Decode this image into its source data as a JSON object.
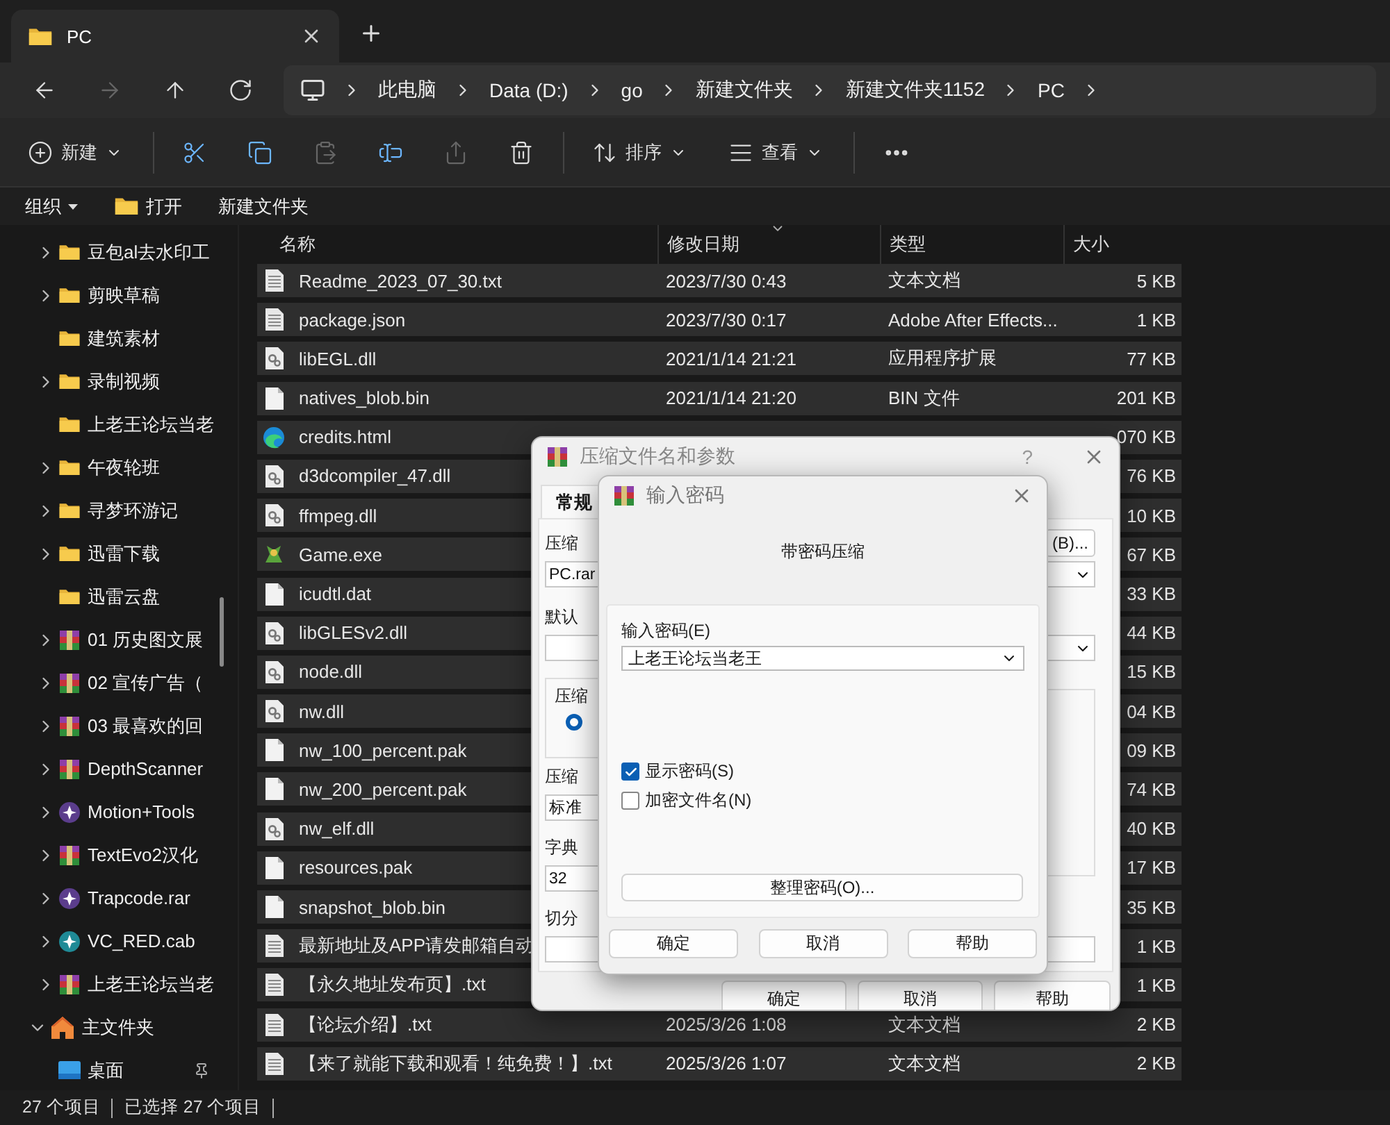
{
  "tab": {
    "title": "PC"
  },
  "nav_buttons": [
    {
      "kind": "back",
      "disabled": false
    },
    {
      "kind": "forward",
      "disabled": true
    },
    {
      "kind": "up",
      "disabled": false
    },
    {
      "kind": "refresh",
      "disabled": false
    }
  ],
  "breadcrumb": [
    "此电脑",
    "Data (D:)",
    "go",
    "新建文件夹",
    "新建文件夹1152",
    "PC"
  ],
  "toolbar": [
    {
      "kind": "new",
      "label": "新建",
      "disabled": false
    },
    {
      "kind": "cut",
      "disabled": false
    },
    {
      "kind": "copy",
      "disabled": false
    },
    {
      "kind": "paste",
      "disabled": true
    },
    {
      "kind": "rename",
      "disabled": false
    },
    {
      "kind": "share",
      "disabled": true
    },
    {
      "kind": "delete",
      "disabled": false
    },
    {
      "kind": "sort",
      "label": "排序",
      "disabled": false
    },
    {
      "kind": "view",
      "label": "查看",
      "disabled": false
    },
    {
      "kind": "more",
      "disabled": false
    }
  ],
  "command_bar": [
    {
      "kind": "menu",
      "label": "组织"
    },
    {
      "kind": "open",
      "label": "打开"
    },
    {
      "kind": "plain",
      "label": "新建文件夹"
    }
  ],
  "sidebar": {
    "items": [
      {
        "label": "豆包al去水印工",
        "kind": "folder",
        "expandable": true
      },
      {
        "label": "剪映草稿",
        "kind": "folder",
        "expandable": true
      },
      {
        "label": "建筑素材",
        "kind": "folder",
        "expandable": false
      },
      {
        "label": "录制视频",
        "kind": "folder",
        "expandable": true
      },
      {
        "label": "上老王论坛当老",
        "kind": "folder",
        "expandable": false
      },
      {
        "label": "午夜轮班",
        "kind": "folder",
        "expandable": true
      },
      {
        "label": "寻梦环游记",
        "kind": "folder",
        "expandable": true
      },
      {
        "label": "迅雷下载",
        "kind": "folder",
        "expandable": true
      },
      {
        "label": "迅雷云盘",
        "kind": "folder",
        "expandable": false
      },
      {
        "label": "01 历史图文展",
        "kind": "rar",
        "expandable": true
      },
      {
        "label": "02 宣传广告（",
        "kind": "rar",
        "expandable": true
      },
      {
        "label": "03 最喜欢的回",
        "kind": "rar",
        "expandable": true
      },
      {
        "label": "DepthScanner",
        "kind": "rar",
        "expandable": true
      },
      {
        "label": "Motion+Tools",
        "kind": "badge",
        "expandable": true
      },
      {
        "label": "TextEvo2汉化",
        "kind": "rar",
        "expandable": true
      },
      {
        "label": "Trapcode.rar",
        "kind": "badge",
        "expandable": true
      },
      {
        "label": "VC_RED.cab",
        "kind": "cab",
        "expandable": true
      },
      {
        "label": "上老王论坛当老",
        "kind": "rar",
        "expandable": true
      }
    ],
    "home": {
      "label": "主文件夹",
      "expanded": true,
      "children": [
        {
          "label": "桌面",
          "kind": "desktop",
          "pinned": true
        }
      ]
    }
  },
  "table": {
    "columns": [
      {
        "label": "名称",
        "sorted": false
      },
      {
        "label": "修改日期",
        "sorted": true
      },
      {
        "label": "类型",
        "sorted": false
      },
      {
        "label": "大小",
        "sorted": false
      }
    ],
    "rows": [
      {
        "kind": "text",
        "name": "Readme_2023_07_30.txt",
        "date": "2023/7/30 0:43",
        "type": "文本文档",
        "size": "5 KB",
        "selected": true
      },
      {
        "kind": "text",
        "name": "package.json",
        "date": "2023/7/30 0:17",
        "type": "Adobe After Effects...",
        "size": "1 KB",
        "selected": true
      },
      {
        "kind": "dll",
        "name": "libEGL.dll",
        "date": "2021/1/14 21:21",
        "type": "应用程序扩展",
        "size": "77 KB",
        "selected": true
      },
      {
        "kind": "file",
        "name": "natives_blob.bin",
        "date": "2021/1/14 21:20",
        "type": "BIN 文件",
        "size": "201 KB",
        "selected": true
      },
      {
        "kind": "edge",
        "name": "credits.html",
        "size": "070 KB",
        "selected": true
      },
      {
        "kind": "dll",
        "name": "d3dcompiler_47.dll",
        "size": "76 KB",
        "selected": true
      },
      {
        "kind": "dll",
        "name": "ffmpeg.dll",
        "size": "10 KB",
        "selected": true
      },
      {
        "kind": "game",
        "name": "Game.exe",
        "size": "67 KB",
        "selected": true
      },
      {
        "kind": "file",
        "name": "icudtl.dat",
        "size": "33 KB",
        "selected": true
      },
      {
        "kind": "dll",
        "name": "libGLESv2.dll",
        "size": "44 KB",
        "selected": true
      },
      {
        "kind": "dll",
        "name": "node.dll",
        "size": "15 KB",
        "selected": true
      },
      {
        "kind": "dll",
        "name": "nw.dll",
        "size": "04 KB",
        "selected": true
      },
      {
        "kind": "file",
        "name": "nw_100_percent.pak",
        "size": "09 KB",
        "selected": true
      },
      {
        "kind": "file",
        "name": "nw_200_percent.pak",
        "size": "74 KB",
        "selected": true
      },
      {
        "kind": "dll",
        "name": "nw_elf.dll",
        "size": "40 KB",
        "selected": true
      },
      {
        "kind": "file",
        "name": "resources.pak",
        "size": "17 KB",
        "selected": true
      },
      {
        "kind": "file",
        "name": "snapshot_blob.bin",
        "size": "35 KB",
        "selected": true
      },
      {
        "kind": "text",
        "name": "最新地址及APP请发邮箱自动",
        "size": "1 KB",
        "selected": true
      },
      {
        "kind": "text",
        "name": "【永久地址发布页】.txt",
        "size": "1 KB",
        "selected": true
      },
      {
        "kind": "text",
        "name": "【论坛介绍】.txt",
        "date": "2025/3/26 1:08",
        "type": "文本文档",
        "size": "2 KB",
        "selected": true
      },
      {
        "kind": "text",
        "name": "【来了就能下载和观看！纯免费！】.txt",
        "date": "2025/3/26 1:07",
        "type": "文本文档",
        "size": "2 KB",
        "selected": true
      }
    ]
  },
  "status_bar": {
    "count": "27 个项目",
    "selection": "已选择 27 个项目"
  },
  "archive_dialog": {
    "title": "压缩文件名和参数",
    "help": "?",
    "tabs": [
      {
        "label": "常规",
        "selected": true
      }
    ],
    "archive_name_label": "压缩",
    "browse_button": "(B)...",
    "archive_name": "PC.rar",
    "profile_label": "默认",
    "format_group_label": "压缩",
    "format_radio": {
      "selected": true
    },
    "method_label": "压缩",
    "method": "标准",
    "dictionary_label": "字典",
    "dictionary": "32",
    "split_label": "切分",
    "buttons": [
      "确定",
      "取消",
      "帮助"
    ]
  },
  "password_dialog": {
    "title": "输入密码",
    "heading": "带密码压缩",
    "password_label": "输入密码(E)",
    "password": "上老王论坛当老王",
    "options": [
      {
        "label": "显示密码(S)",
        "checked": true
      },
      {
        "label": "加密文件名(N)",
        "checked": false
      }
    ],
    "organize_button": "整理密码(O)...",
    "buttons": [
      "确定",
      "取消",
      "帮助"
    ]
  }
}
